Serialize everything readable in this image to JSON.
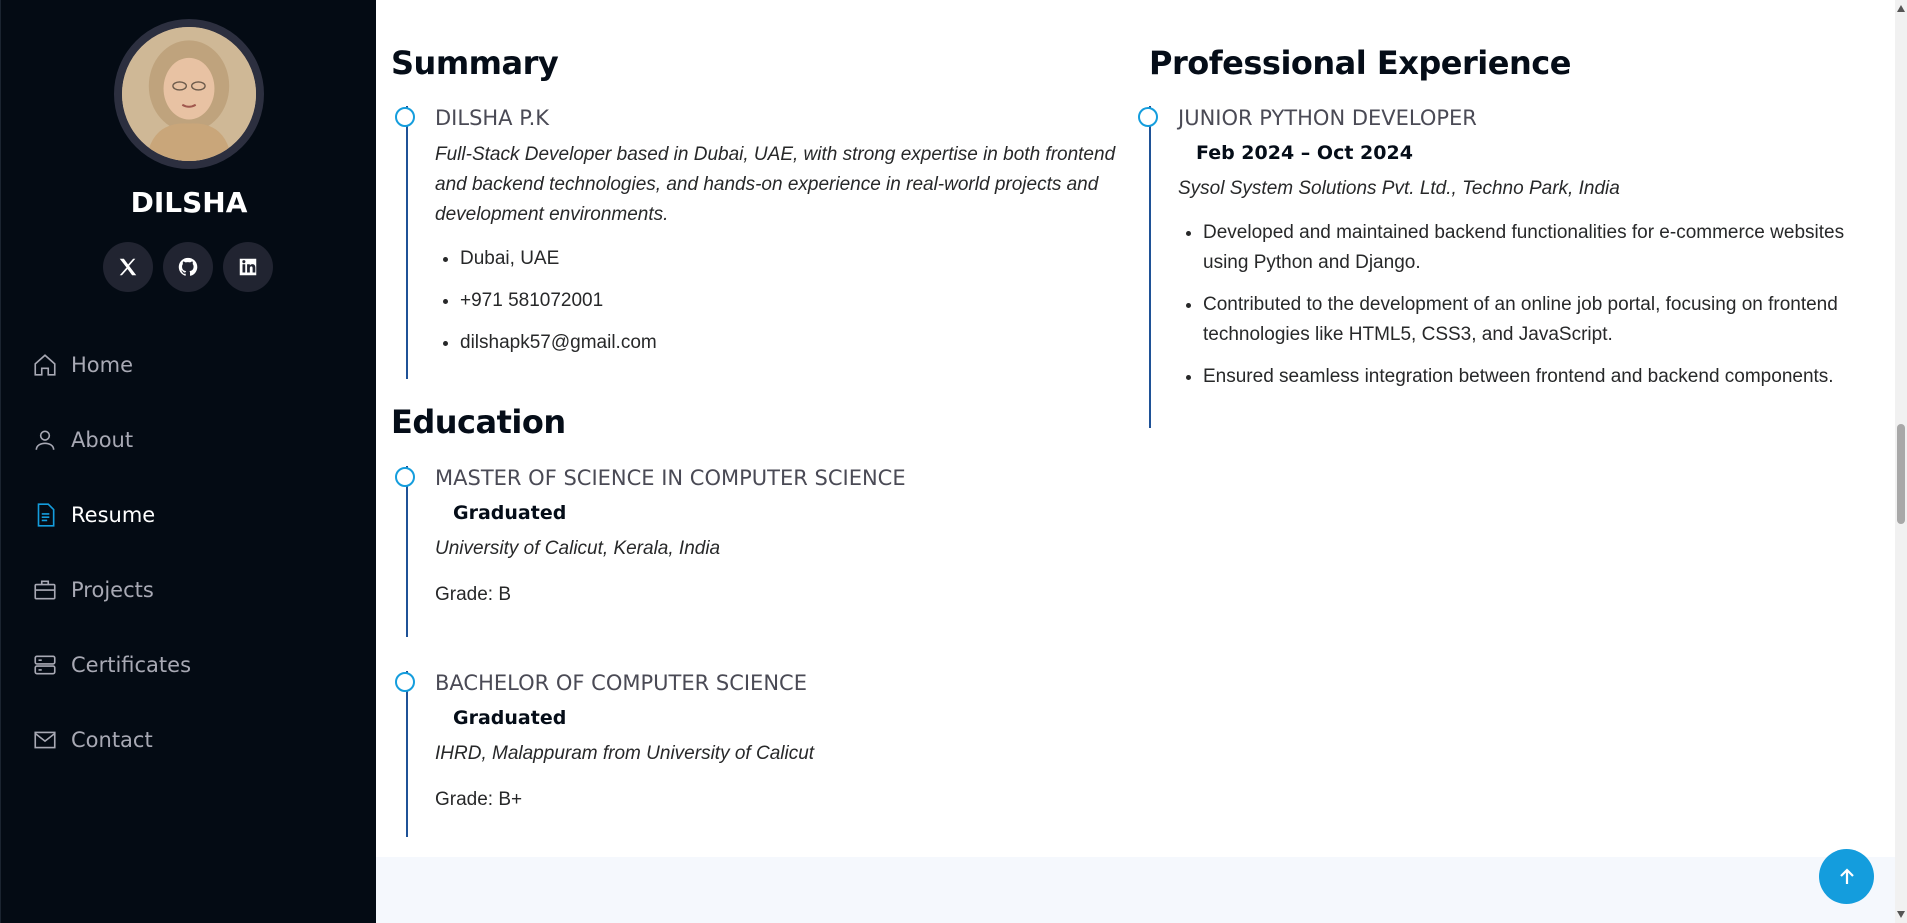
{
  "sidebar": {
    "name": "DILSHA",
    "social": [
      {
        "icon": "x-twitter-icon"
      },
      {
        "icon": "github-icon"
      },
      {
        "icon": "linkedin-icon"
      }
    ],
    "nav": [
      {
        "label": "Home",
        "icon": "home-icon"
      },
      {
        "label": "About",
        "icon": "person-icon"
      },
      {
        "label": "Resume",
        "icon": "file-text-icon",
        "active": true
      },
      {
        "label": "Projects",
        "icon": "briefcase-icon"
      },
      {
        "label": "Certificates",
        "icon": "server-icon"
      },
      {
        "label": "Contact",
        "icon": "envelope-icon"
      }
    ]
  },
  "summary": {
    "title": "Summary",
    "name": "DILSHA P.K",
    "description": "Full-Stack Developer based in Dubai, UAE, with strong expertise in both frontend and backend technologies, and hands-on experience in real-world projects and development environments.",
    "contacts": [
      "Dubai, UAE",
      "+971 581072001",
      "dilshapk57@gmail.com"
    ]
  },
  "education": {
    "title": "Education",
    "items": [
      {
        "degree": "MASTER OF SCIENCE IN COMPUTER SCIENCE",
        "status": "Graduated",
        "institution": "University of Calicut, Kerala, India",
        "grade": "Grade: B"
      },
      {
        "degree": "BACHELOR OF COMPUTER SCIENCE",
        "status": "Graduated",
        "institution": "IHRD, Malappuram from University of Calicut",
        "grade": "Grade: B+"
      }
    ]
  },
  "experience": {
    "title": "Professional Experience",
    "role": "JUNIOR PYTHON DEVELOPER",
    "period": "Feb 2024 – Oct 2024",
    "company": "Sysol System Solutions Pvt. Ltd., Techno Park, India",
    "bullets": [
      "Developed and maintained backend functionalities for e-commerce websites using Python and Django.",
      "Contributed to the development of an online job portal, focusing on frontend technologies like HTML5, CSS3, and JavaScript.",
      "Ensured seamless integration between frontend and backend components."
    ]
  },
  "colors": {
    "accent": "#149ddd",
    "sidebar_bg": "#040b14",
    "footer_bg": "#f5f8fd"
  }
}
